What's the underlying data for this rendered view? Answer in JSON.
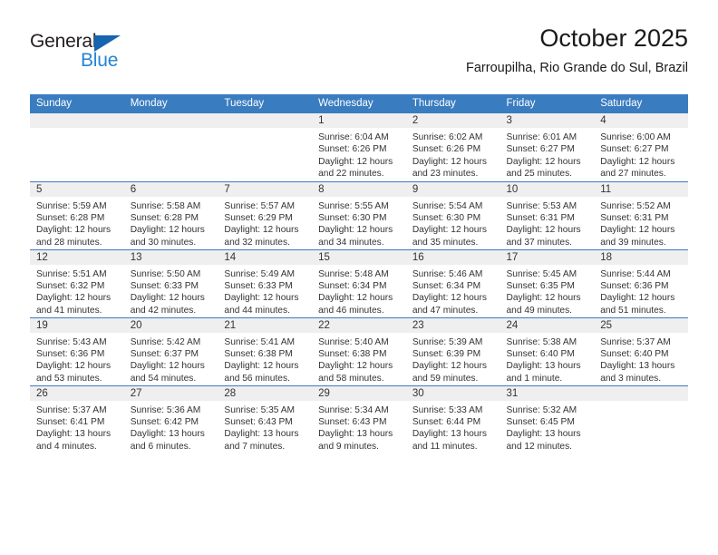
{
  "brand": {
    "name_top": "General",
    "name_bottom": "Blue",
    "accent_blue": "#2484d6",
    "triangle_blue": "#1565b0"
  },
  "header": {
    "title": "October 2025",
    "subtitle": "Farroupilha, Rio Grande do Sul, Brazil"
  },
  "theme": {
    "header_row_bg": "#3a7cc0",
    "daynum_bg": "#efefef",
    "rule_color": "#3a7cc0",
    "text_color": "#333333"
  },
  "weekday_headers": [
    "Sunday",
    "Monday",
    "Tuesday",
    "Wednesday",
    "Thursday",
    "Friday",
    "Saturday"
  ],
  "labels": {
    "sunrise_prefix": "Sunrise:",
    "sunset_prefix": "Sunset:",
    "daylight_prefix": "Daylight:"
  },
  "weeks": [
    [
      {
        "day": "",
        "empty": true,
        "l1": "",
        "l2": "",
        "l3": "",
        "l4": ""
      },
      {
        "day": "",
        "empty": true,
        "l1": "",
        "l2": "",
        "l3": "",
        "l4": ""
      },
      {
        "day": "",
        "empty": true,
        "l1": "",
        "l2": "",
        "l3": "",
        "l4": ""
      },
      {
        "day": "1",
        "empty": false,
        "l1": "Sunrise: 6:04 AM",
        "l2": "Sunset: 6:26 PM",
        "l3": "Daylight: 12 hours",
        "l4": "and 22 minutes."
      },
      {
        "day": "2",
        "empty": false,
        "l1": "Sunrise: 6:02 AM",
        "l2": "Sunset: 6:26 PM",
        "l3": "Daylight: 12 hours",
        "l4": "and 23 minutes."
      },
      {
        "day": "3",
        "empty": false,
        "l1": "Sunrise: 6:01 AM",
        "l2": "Sunset: 6:27 PM",
        "l3": "Daylight: 12 hours",
        "l4": "and 25 minutes."
      },
      {
        "day": "4",
        "empty": false,
        "l1": "Sunrise: 6:00 AM",
        "l2": "Sunset: 6:27 PM",
        "l3": "Daylight: 12 hours",
        "l4": "and 27 minutes."
      }
    ],
    [
      {
        "day": "5",
        "empty": false,
        "l1": "Sunrise: 5:59 AM",
        "l2": "Sunset: 6:28 PM",
        "l3": "Daylight: 12 hours",
        "l4": "and 28 minutes."
      },
      {
        "day": "6",
        "empty": false,
        "l1": "Sunrise: 5:58 AM",
        "l2": "Sunset: 6:28 PM",
        "l3": "Daylight: 12 hours",
        "l4": "and 30 minutes."
      },
      {
        "day": "7",
        "empty": false,
        "l1": "Sunrise: 5:57 AM",
        "l2": "Sunset: 6:29 PM",
        "l3": "Daylight: 12 hours",
        "l4": "and 32 minutes."
      },
      {
        "day": "8",
        "empty": false,
        "l1": "Sunrise: 5:55 AM",
        "l2": "Sunset: 6:30 PM",
        "l3": "Daylight: 12 hours",
        "l4": "and 34 minutes."
      },
      {
        "day": "9",
        "empty": false,
        "l1": "Sunrise: 5:54 AM",
        "l2": "Sunset: 6:30 PM",
        "l3": "Daylight: 12 hours",
        "l4": "and 35 minutes."
      },
      {
        "day": "10",
        "empty": false,
        "l1": "Sunrise: 5:53 AM",
        "l2": "Sunset: 6:31 PM",
        "l3": "Daylight: 12 hours",
        "l4": "and 37 minutes."
      },
      {
        "day": "11",
        "empty": false,
        "l1": "Sunrise: 5:52 AM",
        "l2": "Sunset: 6:31 PM",
        "l3": "Daylight: 12 hours",
        "l4": "and 39 minutes."
      }
    ],
    [
      {
        "day": "12",
        "empty": false,
        "l1": "Sunrise: 5:51 AM",
        "l2": "Sunset: 6:32 PM",
        "l3": "Daylight: 12 hours",
        "l4": "and 41 minutes."
      },
      {
        "day": "13",
        "empty": false,
        "l1": "Sunrise: 5:50 AM",
        "l2": "Sunset: 6:33 PM",
        "l3": "Daylight: 12 hours",
        "l4": "and 42 minutes."
      },
      {
        "day": "14",
        "empty": false,
        "l1": "Sunrise: 5:49 AM",
        "l2": "Sunset: 6:33 PM",
        "l3": "Daylight: 12 hours",
        "l4": "and 44 minutes."
      },
      {
        "day": "15",
        "empty": false,
        "l1": "Sunrise: 5:48 AM",
        "l2": "Sunset: 6:34 PM",
        "l3": "Daylight: 12 hours",
        "l4": "and 46 minutes."
      },
      {
        "day": "16",
        "empty": false,
        "l1": "Sunrise: 5:46 AM",
        "l2": "Sunset: 6:34 PM",
        "l3": "Daylight: 12 hours",
        "l4": "and 47 minutes."
      },
      {
        "day": "17",
        "empty": false,
        "l1": "Sunrise: 5:45 AM",
        "l2": "Sunset: 6:35 PM",
        "l3": "Daylight: 12 hours",
        "l4": "and 49 minutes."
      },
      {
        "day": "18",
        "empty": false,
        "l1": "Sunrise: 5:44 AM",
        "l2": "Sunset: 6:36 PM",
        "l3": "Daylight: 12 hours",
        "l4": "and 51 minutes."
      }
    ],
    [
      {
        "day": "19",
        "empty": false,
        "l1": "Sunrise: 5:43 AM",
        "l2": "Sunset: 6:36 PM",
        "l3": "Daylight: 12 hours",
        "l4": "and 53 minutes."
      },
      {
        "day": "20",
        "empty": false,
        "l1": "Sunrise: 5:42 AM",
        "l2": "Sunset: 6:37 PM",
        "l3": "Daylight: 12 hours",
        "l4": "and 54 minutes."
      },
      {
        "day": "21",
        "empty": false,
        "l1": "Sunrise: 5:41 AM",
        "l2": "Sunset: 6:38 PM",
        "l3": "Daylight: 12 hours",
        "l4": "and 56 minutes."
      },
      {
        "day": "22",
        "empty": false,
        "l1": "Sunrise: 5:40 AM",
        "l2": "Sunset: 6:38 PM",
        "l3": "Daylight: 12 hours",
        "l4": "and 58 minutes."
      },
      {
        "day": "23",
        "empty": false,
        "l1": "Sunrise: 5:39 AM",
        "l2": "Sunset: 6:39 PM",
        "l3": "Daylight: 12 hours",
        "l4": "and 59 minutes."
      },
      {
        "day": "24",
        "empty": false,
        "l1": "Sunrise: 5:38 AM",
        "l2": "Sunset: 6:40 PM",
        "l3": "Daylight: 13 hours",
        "l4": "and 1 minute."
      },
      {
        "day": "25",
        "empty": false,
        "l1": "Sunrise: 5:37 AM",
        "l2": "Sunset: 6:40 PM",
        "l3": "Daylight: 13 hours",
        "l4": "and 3 minutes."
      }
    ],
    [
      {
        "day": "26",
        "empty": false,
        "l1": "Sunrise: 5:37 AM",
        "l2": "Sunset: 6:41 PM",
        "l3": "Daylight: 13 hours",
        "l4": "and 4 minutes."
      },
      {
        "day": "27",
        "empty": false,
        "l1": "Sunrise: 5:36 AM",
        "l2": "Sunset: 6:42 PM",
        "l3": "Daylight: 13 hours",
        "l4": "and 6 minutes."
      },
      {
        "day": "28",
        "empty": false,
        "l1": "Sunrise: 5:35 AM",
        "l2": "Sunset: 6:43 PM",
        "l3": "Daylight: 13 hours",
        "l4": "and 7 minutes."
      },
      {
        "day": "29",
        "empty": false,
        "l1": "Sunrise: 5:34 AM",
        "l2": "Sunset: 6:43 PM",
        "l3": "Daylight: 13 hours",
        "l4": "and 9 minutes."
      },
      {
        "day": "30",
        "empty": false,
        "l1": "Sunrise: 5:33 AM",
        "l2": "Sunset: 6:44 PM",
        "l3": "Daylight: 13 hours",
        "l4": "and 11 minutes."
      },
      {
        "day": "31",
        "empty": false,
        "l1": "Sunrise: 5:32 AM",
        "l2": "Sunset: 6:45 PM",
        "l3": "Daylight: 13 hours",
        "l4": "and 12 minutes."
      },
      {
        "day": "",
        "empty": true,
        "l1": "",
        "l2": "",
        "l3": "",
        "l4": ""
      }
    ]
  ]
}
